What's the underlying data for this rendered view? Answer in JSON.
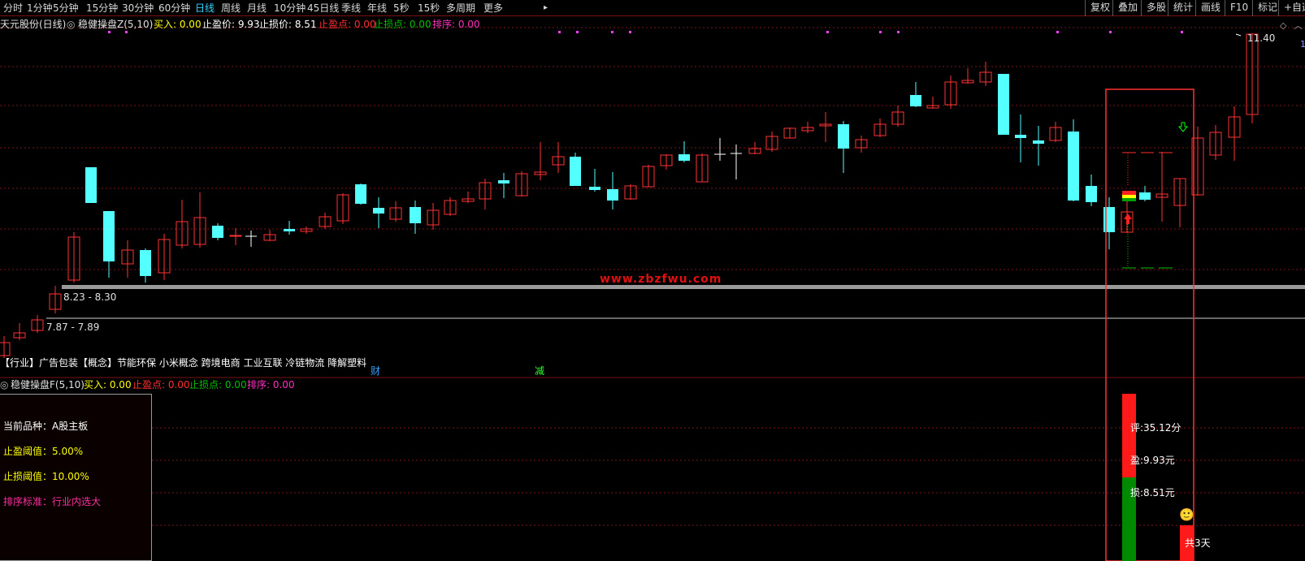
{
  "toolbar": {
    "periods": [
      "分时",
      "1分钟",
      "5分钟",
      "15分钟",
      "30分钟",
      "60分钟",
      "日线",
      "周线",
      "月线",
      "10分钟",
      "45日线",
      "季线",
      "年线",
      "5秒",
      "15秒",
      "多周期",
      "更多"
    ],
    "active_period": "日线",
    "right_buttons": [
      "复权",
      "叠加",
      "多股",
      "统计",
      "画线",
      "F10",
      "标记",
      "+自选"
    ]
  },
  "main_header": {
    "stock_name": "天元股份(日线)",
    "indicator": "稳健操盘Z(5,10)",
    "buy": "买入: 0.00",
    "take_profit_price": "止盈价: 9.93",
    "stop_loss_price": "止损价: 8.51",
    "take_profit_point": "止盈点: 0.00",
    "stop_loss_point": "止损点: 0.00",
    "rank": "排序: 0.00"
  },
  "price_labels": {
    "high": "11.40",
    "band_upper": "8.23 - 8.30",
    "band_lower": "7.87 - 7.89",
    "right_edge": "1"
  },
  "watermark": "www.zbzfwu.com",
  "tags_line": "【行业】广告包装【概念】节能环保 小米概念 跨境电商 工业互联 冷链物流 降解塑料",
  "markers": {
    "cai": "财",
    "jian": "减"
  },
  "sub_header": {
    "indicator": "稳健操盘F(5,10)",
    "buy": "买入: 0.00",
    "take_profit_point": "止盈点: 0.00",
    "stop_loss_point": "止损点: 0.00",
    "rank": "排序: 0.00"
  },
  "info_panel": {
    "category": "当前品种：A股主板",
    "take_profit_threshold": "止盈阈值：5.00%",
    "stop_loss_threshold": "止损阈值：10.00%",
    "rank_standard": "排序标准：行业内选大"
  },
  "sub_labels": {
    "score": "评:35.12分",
    "profit": "盈:9.93元",
    "loss": "损:8.51元",
    "days": "共3天"
  },
  "colors": {
    "up": "#ff3232",
    "down": "#54ffff",
    "flat": "#ffffff",
    "grid": "#7a1616",
    "panel_border": "#9a9a9a"
  }
}
